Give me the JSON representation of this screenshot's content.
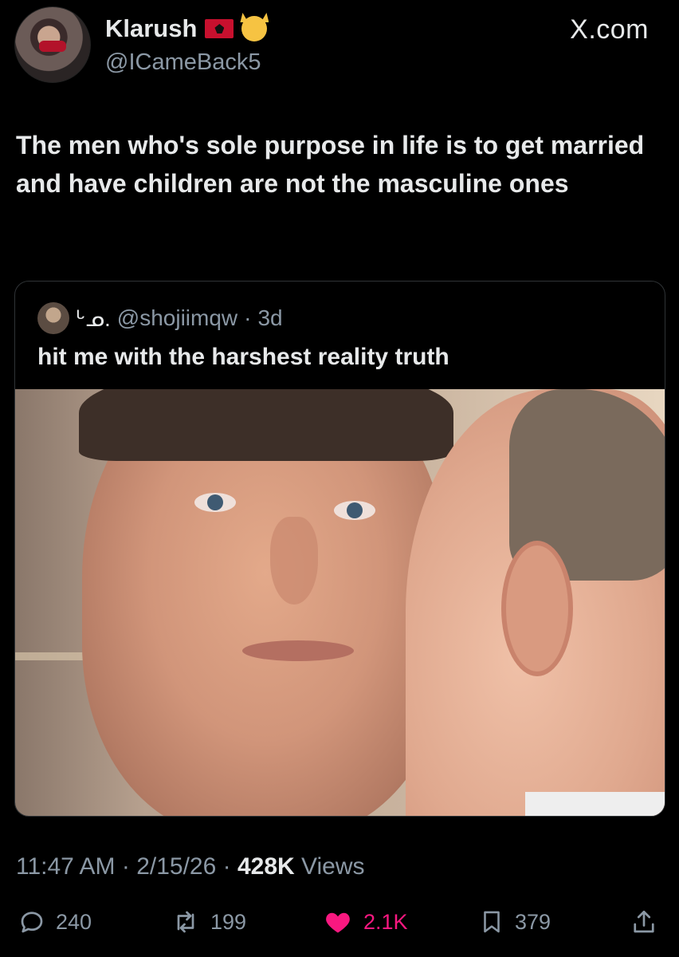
{
  "header": {
    "display_name": "Klarush",
    "handle": "@ICameBack5",
    "site_label": "X.com",
    "icons": [
      "albania-flag-emoji",
      "kissing-cat-emoji"
    ]
  },
  "tweet": {
    "text": "The men who's sole purpose in life is to get married and have children are not the masculine ones"
  },
  "quote": {
    "name": "ᒡᓄ.",
    "handle": "@shojiimqw",
    "age": "3d",
    "text": "hit me with the harshest reality truth"
  },
  "meta": {
    "time": "11:47 AM",
    "date": "2/15/26",
    "views_count": "428K",
    "views_label": "Views"
  },
  "actions": {
    "replies": "240",
    "reposts": "199",
    "likes": "2.1K",
    "bookmarks": "379"
  },
  "colors": {
    "background": "#000000",
    "text": "#e7e9ea",
    "secondary": "#8b98a5",
    "like": "#f91880",
    "border": "#2f3336"
  }
}
